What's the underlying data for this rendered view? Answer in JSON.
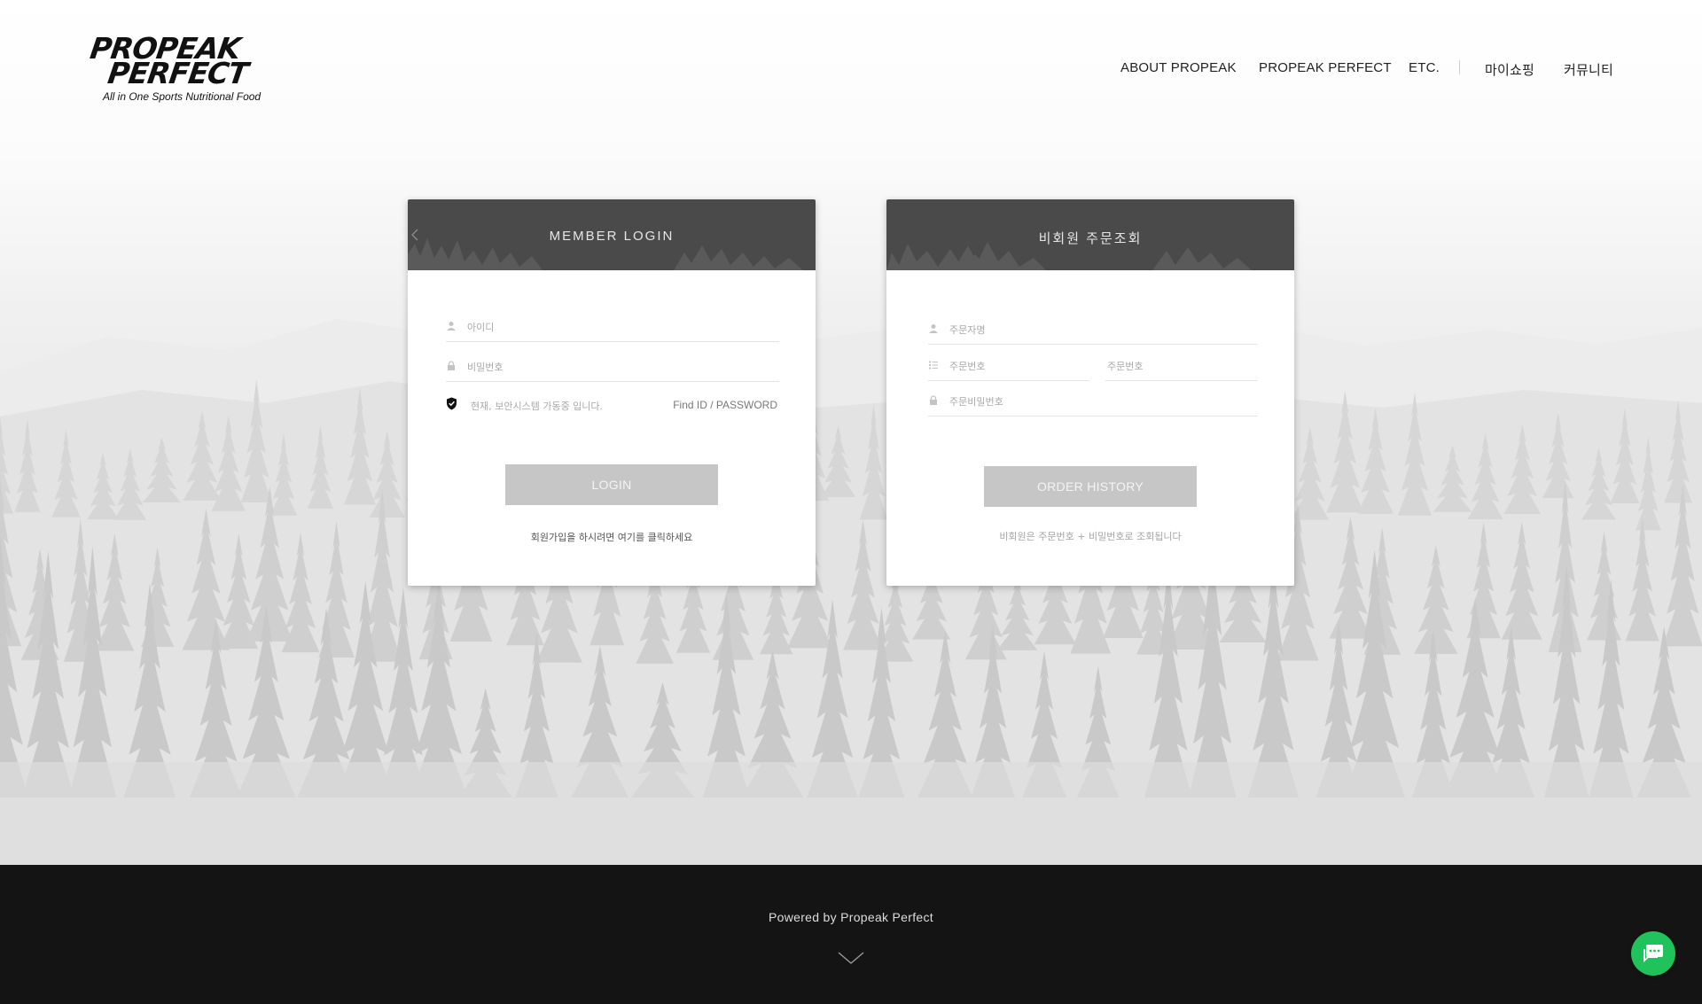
{
  "header": {
    "logo": {
      "line1": "PROPEAK",
      "line2": "PERFECT",
      "tagline": "All in One Sports Nutritional Food"
    },
    "nav": [
      {
        "label": "ABOUT PROPEAK"
      },
      {
        "label": "PROPEAK PERFECT"
      },
      {
        "label": "ETC."
      },
      {
        "label": "마이쇼핑"
      },
      {
        "label": "커뮤니티"
      }
    ]
  },
  "member_login": {
    "title": "MEMBER LOGIN",
    "id_placeholder": "아이디",
    "password_placeholder": "비밀번호",
    "security_text": "현재, 보안시스템 가동중 입니다.",
    "find_link": "Find ID / PASSWORD",
    "login_button": "LOGIN",
    "signup_note": "회원가입을 하시려면 여기를 클릭하세요"
  },
  "guest_order": {
    "title": "비회원 주문조회",
    "orderer_placeholder": "주문자명",
    "order_no_placeholder_1": "주문번호",
    "order_no_placeholder_2": "주문번호",
    "order_password_placeholder": "주문비밀번호",
    "order_button": "ORDER HISTORY",
    "note": "비회원은 주문번호 + 비밀번호로 조회됩니다"
  },
  "footer": {
    "powered_by": "Powered by Propeak Perfect"
  },
  "colors": {
    "card_header": "#4a4a4a",
    "button": "#c6c6c6",
    "footer": "#141414",
    "chat_button": "#1fc25b"
  },
  "icons": {
    "back": "chevron-left-icon",
    "user": "user-icon",
    "lock": "lock-icon",
    "list": "list-icon",
    "secure": "shield-check-icon",
    "scroll": "chevron-down-icon",
    "chat": "chat-icon"
  }
}
